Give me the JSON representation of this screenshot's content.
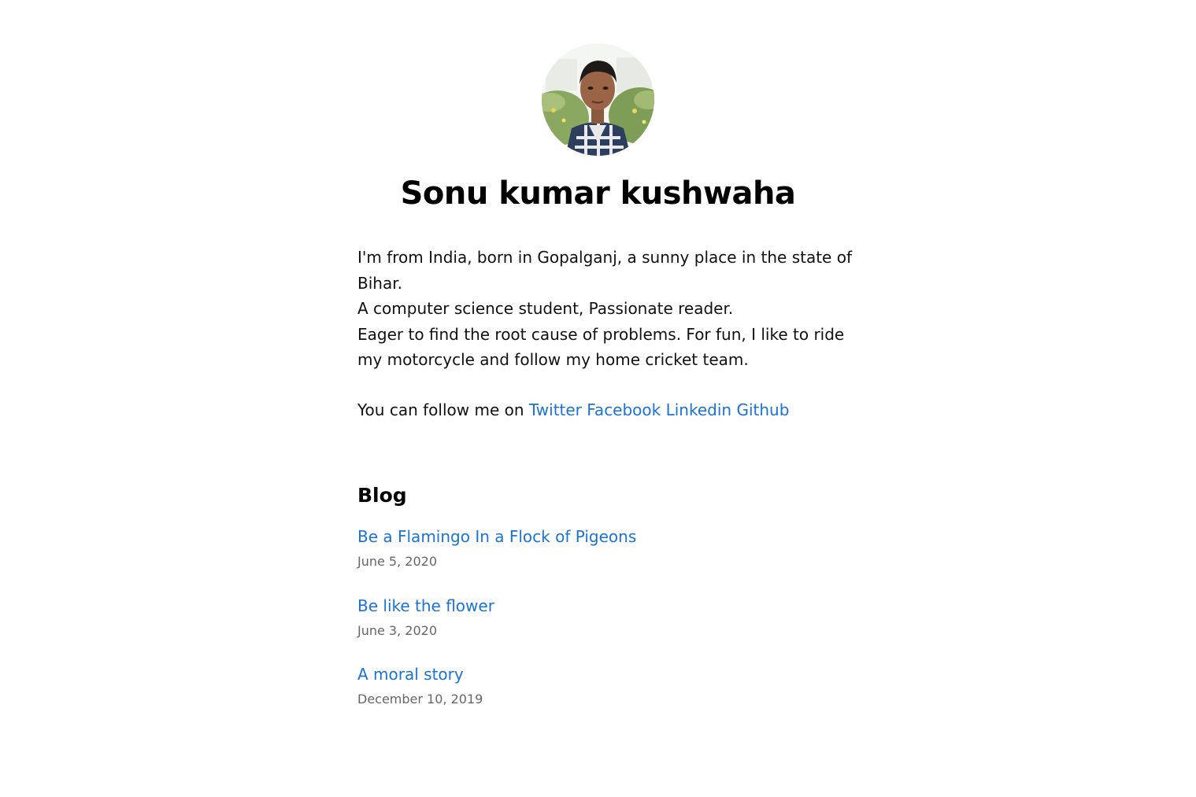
{
  "profile": {
    "name": "Sonu kumar kushwaha",
    "avatar_icon": "profile-photo"
  },
  "bio": {
    "lines": [
      "I'm from India, born in Gopalganj, a sunny place in the state of",
      "Bihar.",
      "A computer science student, Passionate reader.",
      "Eager to find the root cause of problems. For fun, I like to ride",
      "my motorcycle and follow my home cricket team."
    ]
  },
  "follow": {
    "prefix": "You can follow me on",
    "links": [
      "Twitter",
      "Facebook",
      "Linkedin",
      "Github"
    ]
  },
  "blog": {
    "heading": "Blog",
    "posts": [
      {
        "title": "Be a Flamingo In a Flock of Pigeons",
        "date": "June 5, 2020"
      },
      {
        "title": "Be like the flower",
        "date": "June 3, 2020"
      },
      {
        "title": "A moral story",
        "date": "December 10, 2019"
      }
    ]
  },
  "colors": {
    "link": "#1a73d9",
    "text": "#111111",
    "date": "#666666",
    "background": "#ffffff"
  }
}
